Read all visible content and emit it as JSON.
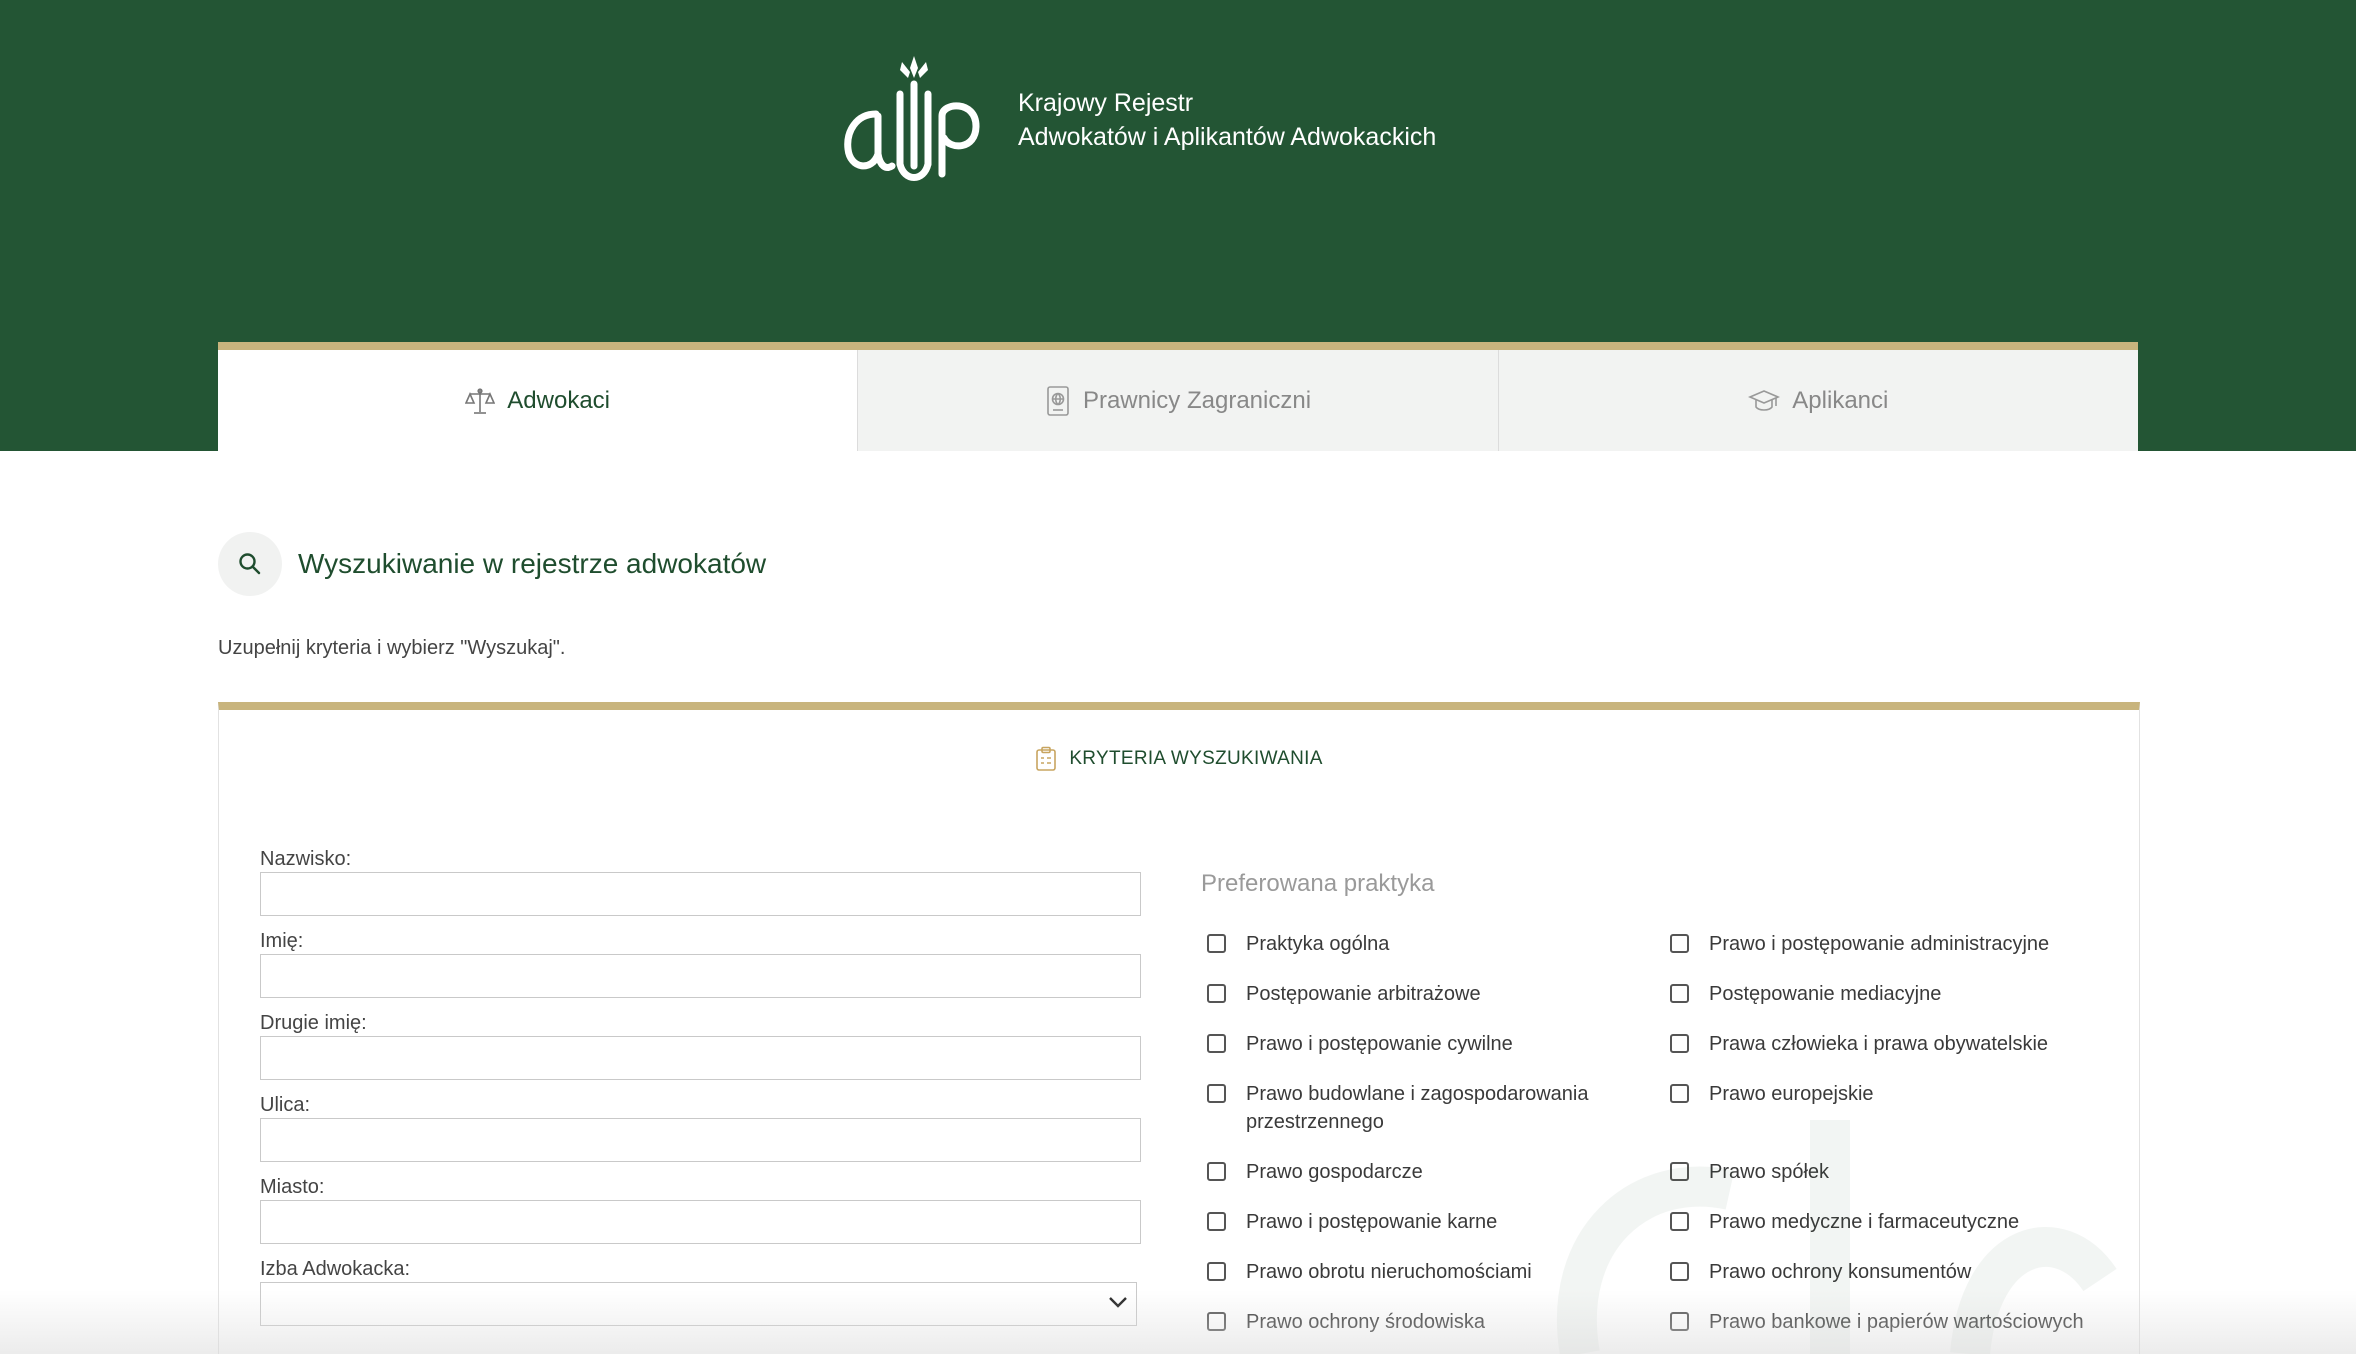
{
  "header": {
    "title_line1": "Krajowy Rejestr",
    "title_line2": "Adwokatów i Aplikantów Adwokackich",
    "logo_icon": "naczelna-rada-adwokacka-logo"
  },
  "tabs": [
    {
      "label": "Adwokaci",
      "icon": "scales-icon",
      "active": true
    },
    {
      "label": "Prawnicy Zagraniczni",
      "icon": "passport-icon",
      "active": false
    },
    {
      "label": "Aplikanci",
      "icon": "graduation-cap-icon",
      "active": false
    }
  ],
  "section": {
    "title": "Wyszukiwanie w rejestrze adwokatów",
    "hint": "Uzupełnij kryteria i wybierz \"Wyszukaj\"."
  },
  "panel": {
    "title": "KRYTERIA WYSZUKIWANIA"
  },
  "form": {
    "surname_label": "Nazwisko:",
    "surname_value": "",
    "first_name_label": "Imię:",
    "first_name_value": "",
    "middle_name_label": "Drugie imię:",
    "middle_name_value": "",
    "street_label": "Ulica:",
    "street_value": "",
    "city_label": "Miasto:",
    "city_value": "",
    "chamber_label": "Izba Adwokacka:",
    "chamber_value": ""
  },
  "practice": {
    "title": "Preferowana praktyka",
    "items": [
      {
        "label": "Praktyka ogólna",
        "checked": false
      },
      {
        "label": "Prawo i postępowanie administracyjne",
        "checked": false
      },
      {
        "label": "Postępowanie arbitrażowe",
        "checked": false
      },
      {
        "label": "Postępowanie mediacyjne",
        "checked": false
      },
      {
        "label": "Prawo i postępowanie cywilne",
        "checked": false
      },
      {
        "label": "Prawa człowieka i prawa obywatelskie",
        "checked": false
      },
      {
        "label": "Prawo budowlane i zagospodarowania przestrzennego",
        "checked": false
      },
      {
        "label": "Prawo europejskie",
        "checked": false
      },
      {
        "label": "Prawo gospodarcze",
        "checked": false
      },
      {
        "label": "Prawo spółek",
        "checked": false
      },
      {
        "label": "Prawo i postępowanie karne",
        "checked": false
      },
      {
        "label": "Prawo medyczne i farmaceutyczne",
        "checked": false
      },
      {
        "label": "Prawo obrotu nieruchomościami",
        "checked": false
      },
      {
        "label": "Prawo ochrony konsumentów",
        "checked": false
      },
      {
        "label": "Prawo ochrony środowiska",
        "checked": false
      },
      {
        "label": "Prawo bankowe i papierów wartościowych",
        "checked": false
      }
    ]
  },
  "colors": {
    "brand_green": "#235534",
    "accent_gold": "#c8b47d",
    "tab_inactive_bg": "#f2f3f2"
  }
}
